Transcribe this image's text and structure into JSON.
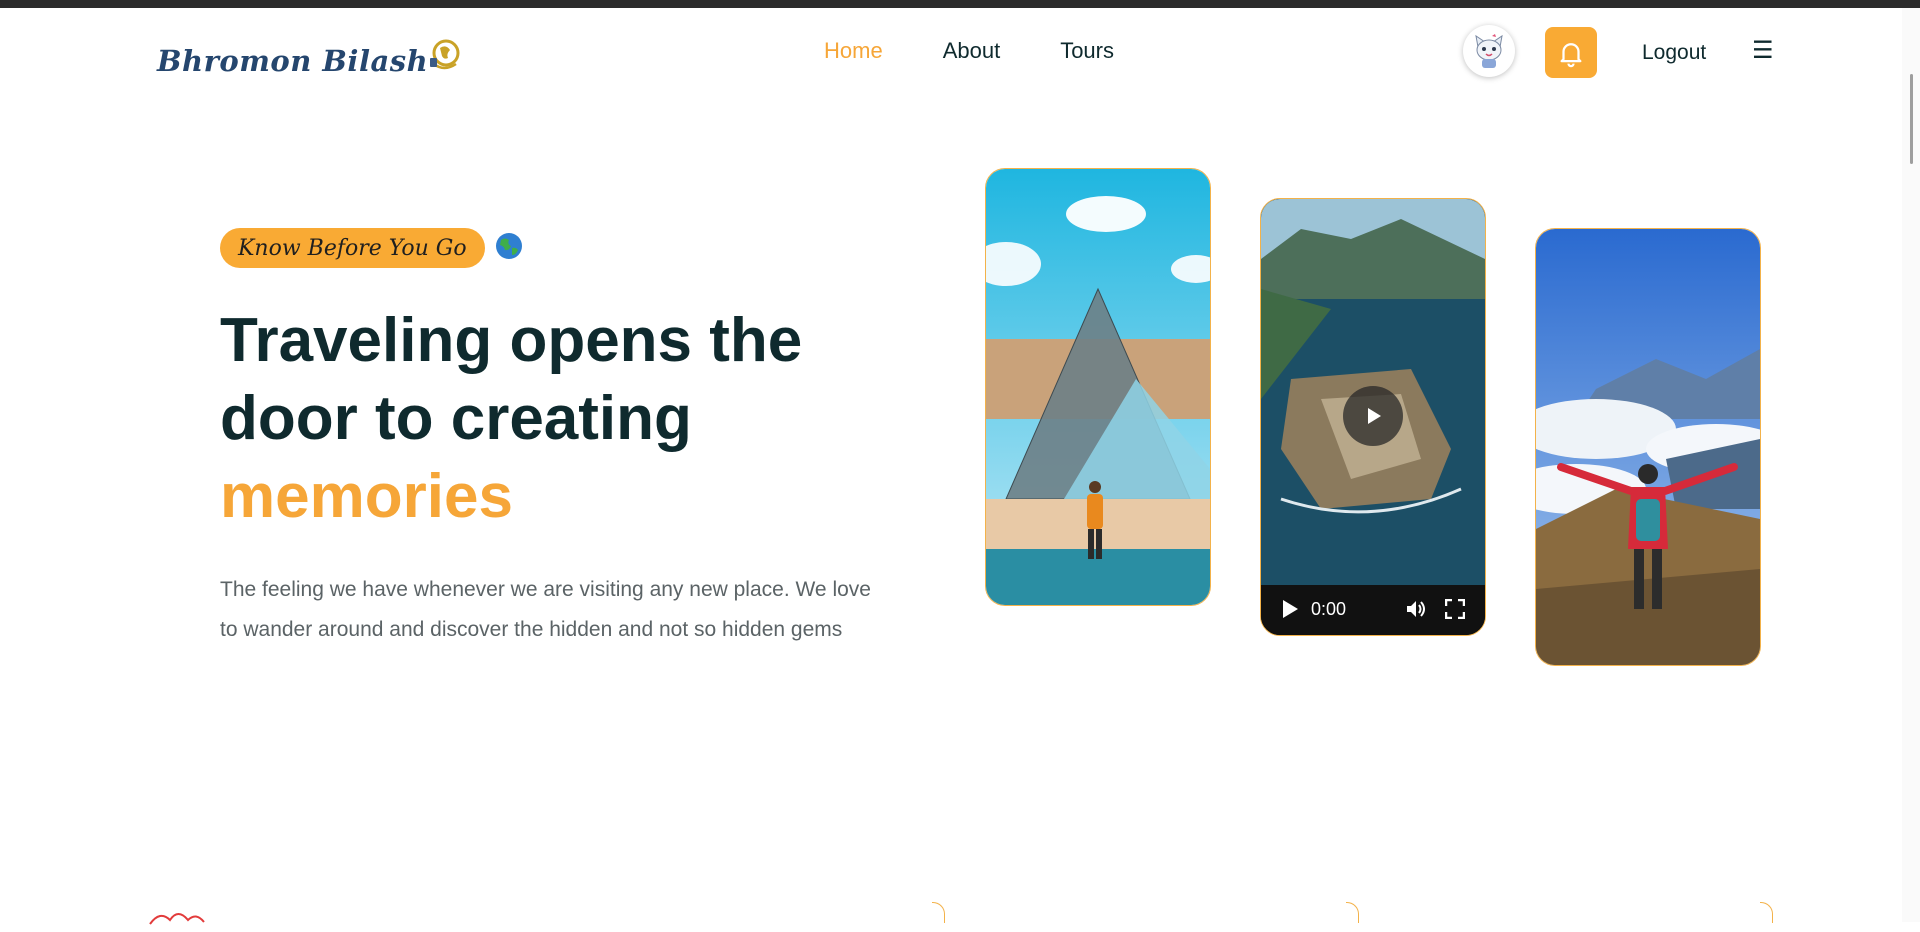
{
  "brand": {
    "name": "Bhromon Bilash"
  },
  "nav": {
    "items": [
      {
        "label": "Home",
        "active": true
      },
      {
        "label": "About",
        "active": false
      },
      {
        "label": "Tours",
        "active": false
      }
    ]
  },
  "header": {
    "logout_label": "Logout",
    "menu_glyph": "☰",
    "avatar_icon": "cat-avatar-icon",
    "bell_icon": "bell-icon"
  },
  "hero": {
    "badge_text": "Know Before You Go",
    "badge_emoji": "🌎",
    "headline_line1": "Traveling opens the",
    "headline_line2": "door to creating",
    "headline_highlight": "memories",
    "subtitle": "The feeling we have whenever we are visiting any new place. We love to wander around and discover the hidden and not so hidden gems"
  },
  "video": {
    "time": "0:00"
  },
  "colors": {
    "accent": "#f9aa34",
    "text_dark": "#0f2a2e",
    "text_muted": "#5b6366",
    "logo_blue": "#25466e"
  }
}
